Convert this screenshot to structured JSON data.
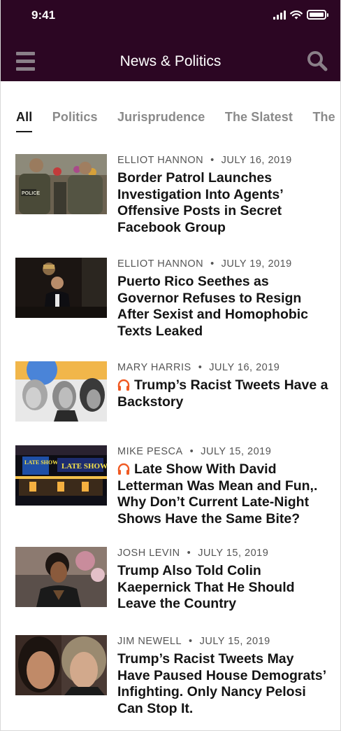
{
  "status": {
    "time": "9:41"
  },
  "header": {
    "title": "News & Politics"
  },
  "tabs": [
    "All",
    "Politics",
    "Jurisprudence",
    "The Slatest",
    "The"
  ],
  "colors": {
    "header_bg": "#2c0623",
    "audio_accent": "#f05a23"
  },
  "articles": [
    {
      "author": "ELLIOT HANNON",
      "date": "JULY 16, 2019",
      "headline": "Border Patrol Launches Investigation Into Agents’ Offensive Posts in Secret Facebook Group",
      "audio": false
    },
    {
      "author": "ELLIOT HANNON",
      "date": "JULY 19, 2019",
      "headline": "Puerto Rico Seethes as Governor Refuses to Resign After Sexist and Homophobic Texts Leaked",
      "audio": false
    },
    {
      "author": "MARY HARRIS",
      "date": "JULY 16, 2019",
      "headline": "Trump’s Racist Tweets Have a Backstory",
      "audio": true
    },
    {
      "author": "MIKE PESCA",
      "date": "JULY 15, 2019",
      "headline": "Late Show With David Letterman Was Mean and Fun,. Why Don’t Current Late-Night Shows Have the Same Bite?",
      "audio": true
    },
    {
      "author": "JOSH LEVIN",
      "date": "JULY 15, 2019",
      "headline": "Trump Also Told Colin Kaepernick That He Should Leave the Country",
      "audio": false
    },
    {
      "author": "JIM NEWELL",
      "date": "JULY 15, 2019",
      "headline": "Trump’s Racist Tweets May Have Paused House Demograts’ Infighting. Only Nancy Pelosi Can Stop It.",
      "audio": false
    }
  ],
  "thumb_signs": {
    "late_show_1": "LATE SHOW",
    "late_show_2": "LATE SHOW",
    "police": "POLICE"
  }
}
